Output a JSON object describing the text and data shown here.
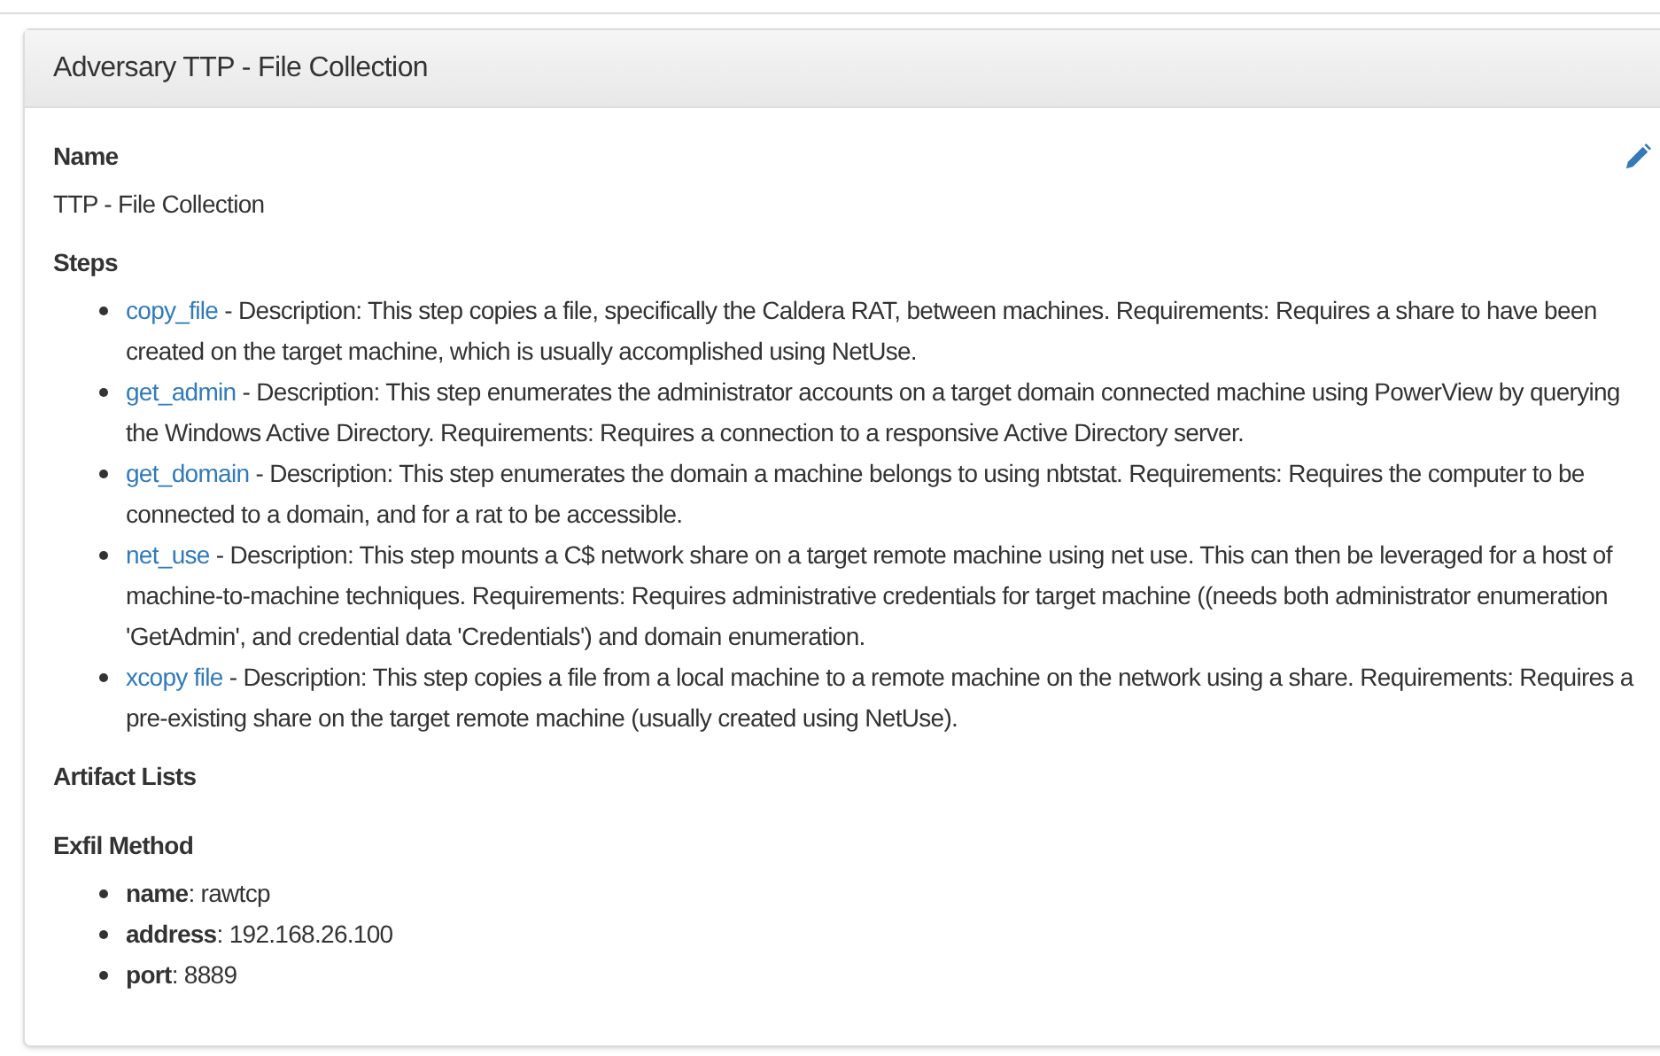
{
  "panel": {
    "title": "Adversary TTP - File Collection"
  },
  "name_section": {
    "heading": "Name",
    "value": "TTP - File Collection"
  },
  "steps_section": {
    "heading": "Steps",
    "steps": [
      {
        "name": "copy_file",
        "description": "- Description: This step copies a file, specifically the Caldera RAT, between machines. Requirements: Requires a share to have been created on the target machine, which is usually accomplished using NetUse."
      },
      {
        "name": "get_admin",
        "description": "- Description: This step enumerates the administrator accounts on a target domain connected machine using PowerView by querying the Windows Active Directory. Requirements: Requires a connection to a responsive Active Directory server."
      },
      {
        "name": "get_domain",
        "description": "- Description: This step enumerates the domain a machine belongs to using nbtstat. Requirements: Requires the computer to be connected to a domain, and for a rat to be accessible."
      },
      {
        "name": "net_use",
        "description": "- Description: This step mounts a C$ network share on a target remote machine using net use. This can then be leveraged for a host of machine-to-machine techniques. Requirements: Requires administrative credentials for target machine ((needs both administrator enumeration 'GetAdmin', and credential data 'Credentials') and domain enumeration."
      },
      {
        "name": "xcopy file",
        "description": "- Description: This step copies a file from a local machine to a remote machine on the network using a share. Requirements: Requires a pre-existing share on the target remote machine (usually created using NetUse)."
      }
    ]
  },
  "artifact_lists": {
    "heading": "Artifact Lists"
  },
  "exfil_method": {
    "heading": "Exfil Method",
    "items": [
      "**name**: rawtcp",
      "**address**: 192.168.26.100",
      "**port**: 8889"
    ]
  }
}
